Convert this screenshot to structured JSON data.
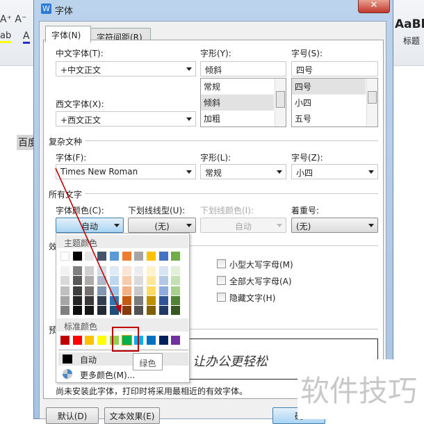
{
  "background": {
    "doc_text": "百度",
    "style_sample": "AaBb",
    "style_label": "标题"
  },
  "dialog": {
    "title": "字体",
    "tabs": [
      {
        "label": "字体(N)",
        "active": true
      },
      {
        "label": "字符间距(R)",
        "active": false
      }
    ],
    "chinese_font": {
      "label": "中文字体(T):",
      "value": "+中文正文"
    },
    "western_font": {
      "label": "西文字体(X):",
      "value": "+西文正文"
    },
    "style": {
      "label": "字形(Y):",
      "value": "倾斜",
      "options": [
        "常规",
        "倾斜",
        "加粗"
      ],
      "selected": "倾斜"
    },
    "size": {
      "label": "字号(S):",
      "value": "四号",
      "options": [
        "四号",
        "小四",
        "五号"
      ],
      "selected": "四号"
    },
    "complex": {
      "section": "复杂文种",
      "font": {
        "label": "字体(F):",
        "value": "Times New Roman"
      },
      "style": {
        "label": "字形(L):",
        "value": "常规"
      },
      "size": {
        "label": "字号(Z):",
        "value": "小四"
      }
    },
    "all_text": {
      "section": "所有文字",
      "font_color": {
        "label": "字体颜色(C):",
        "value": "自动"
      },
      "underline_type": {
        "label": "下划线线型(U):",
        "value": "(无)"
      },
      "underline_color": {
        "label": "下划线颜色(I):",
        "value": "自动",
        "disabled": true
      },
      "emphasis": {
        "label": "着重号:",
        "value": "(无)"
      }
    },
    "effects": {
      "section": "效",
      "checkboxes": [
        {
          "label": "小型大写字母(M)",
          "checked": false
        },
        {
          "label": "全部大写字母(A)",
          "checked": false
        },
        {
          "label": "隐藏文字(H)",
          "checked": false
        }
      ]
    },
    "preview": {
      "section": "预",
      "text": "让办公更轻松"
    },
    "note": "尚未安装此字体，打印时将采用最相近的有效字体。",
    "buttons": {
      "default": "默认(D)",
      "text_effect": "文本效果(E)",
      "ok": "确"
    }
  },
  "color_popup": {
    "theme_header": "主题颜色",
    "theme_colors": [
      "#ffffff",
      "#000000",
      "#e7e6e6",
      "#44546a",
      "#5b9bd5",
      "#ed7d31",
      "#a5a5a5",
      "#ffc000",
      "#4472c4",
      "#70ad47"
    ],
    "tints": [
      [
        "#f2f2f2",
        "#d9d9d9",
        "#bfbfbf",
        "#a6a6a6",
        "#808080"
      ],
      [
        "#808080",
        "#595959",
        "#404040",
        "#262626",
        "#0d0d0d"
      ],
      [
        "#d0cece",
        "#aeaaaa",
        "#757171",
        "#3a3838",
        "#171616"
      ],
      [
        "#d6dce5",
        "#adb9ca",
        "#8497b0",
        "#333f50",
        "#222a35"
      ],
      [
        "#deebf7",
        "#bdd7ee",
        "#9dc3e6",
        "#2e75b6",
        "#1f4e79"
      ],
      [
        "#fbe5d6",
        "#f8cbad",
        "#f4b183",
        "#c55a11",
        "#843c0c"
      ],
      [
        "#ededed",
        "#dbdbdb",
        "#c9c9c9",
        "#7b7b7b",
        "#525252"
      ],
      [
        "#fff2cc",
        "#ffe699",
        "#ffd966",
        "#bf9000",
        "#7f6000"
      ],
      [
        "#dae3f3",
        "#b4c7e7",
        "#8faadc",
        "#2f5597",
        "#203864"
      ],
      [
        "#e2f0d9",
        "#c5e0b4",
        "#a9d18e",
        "#548235",
        "#385723"
      ]
    ],
    "standard_header": "标准颜色",
    "standard_colors": [
      "#c00000",
      "#ff0000",
      "#ffc000",
      "#ffff00",
      "#92d050",
      "#00b050",
      "#00b0f0",
      "#0070c0",
      "#002060",
      "#7030a0"
    ],
    "highlighted_color": "#00b050",
    "auto_label": "自动",
    "more_label": "更多颜色(M)...",
    "tooltip": "绿色"
  },
  "annotation_color": "#c00000",
  "watermark": "软件技巧"
}
